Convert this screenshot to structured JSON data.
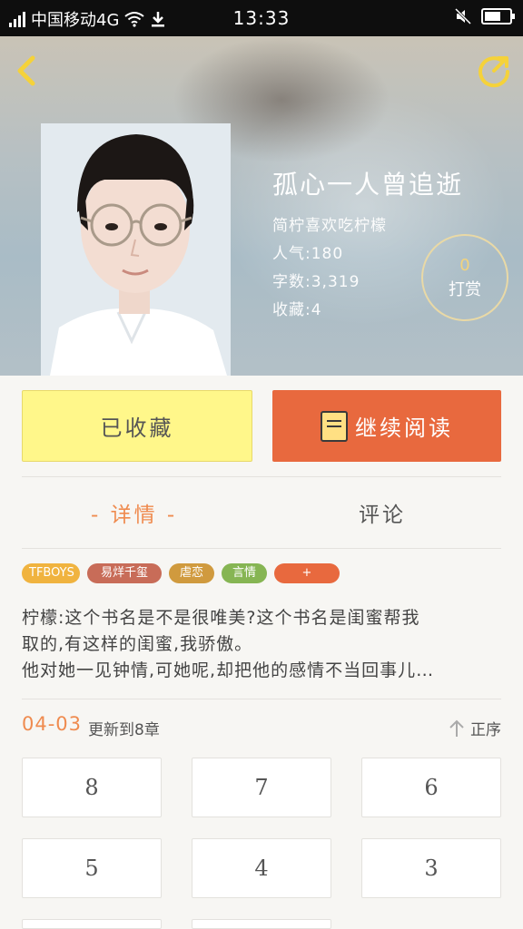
{
  "status_bar": {
    "carrier": "中国移动4G",
    "time": "13:33"
  },
  "book": {
    "title": "孤心一人曾追逝",
    "author": "简柠喜欢吃柠檬",
    "popularity": "人气:180",
    "word_count": "字数:3,319",
    "favorites": "收藏:4"
  },
  "reward": {
    "count": "0",
    "label": "打赏"
  },
  "actions": {
    "favorite_label": "已收藏",
    "continue_label": "继续阅读"
  },
  "tabs": {
    "detail": "- 详情 -",
    "comments": "评论"
  },
  "tags": [
    {
      "label": "TFBOYS",
      "color": "#f0b33f"
    },
    {
      "label": "易烊千玺",
      "color": "#c86c58"
    },
    {
      "label": "虐恋",
      "color": "#d09a3e"
    },
    {
      "label": "言情",
      "color": "#86b553"
    },
    {
      "label": "+",
      "color": "#e8693e"
    }
  ],
  "description": [
    "柠檬:这个书名是不是很唯美?这个书名是闺蜜帮我",
    "取的,有这样的闺蜜,我骄傲。",
    "他对她一见钟情,可她呢,却把他的感情不当回事儿…"
  ],
  "update": {
    "date": "04-03",
    "text": "更新到8章",
    "sort_label": "正序"
  },
  "chapters": [
    "8",
    "7",
    "6",
    "5",
    "4",
    "3"
  ]
}
